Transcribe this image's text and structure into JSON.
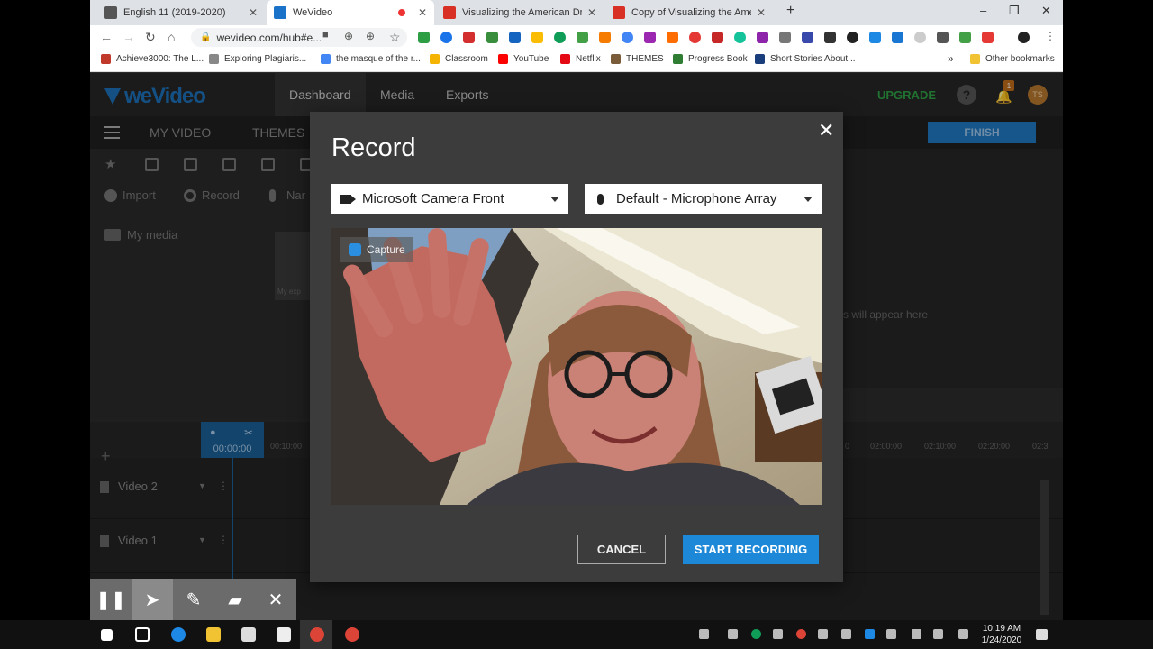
{
  "browser": {
    "tabs": [
      {
        "label": "English 11 (2019-2020)",
        "favicon_color": "#555555",
        "active": false
      },
      {
        "label": "WeVideo",
        "favicon_color": "#1a73c8",
        "active": true
      },
      {
        "label": "Visualizing the American Dream",
        "favicon_color": "#d93025",
        "active": false
      },
      {
        "label": "Copy of Visualizing the American",
        "favicon_color": "#d93025",
        "active": false
      }
    ],
    "new_tab": "+",
    "window_controls": {
      "minimize": "–",
      "maximize": "❐",
      "close": "✕"
    },
    "url": "wevideo.com/hub#e..."
  },
  "bookmarks": [
    {
      "label": "Achieve3000: The L...",
      "color": "#c0392b"
    },
    {
      "label": "Exploring Plagiaris...",
      "color": "#888888"
    },
    {
      "label": "the masque of the r...",
      "color": "#4285f4"
    },
    {
      "label": "Classroom",
      "color": "#f4b400"
    },
    {
      "label": "YouTube",
      "color": "#ff0000"
    },
    {
      "label": "Netflix",
      "color": "#e50914"
    },
    {
      "label": "THEMES",
      "color": "#7a5c3a"
    },
    {
      "label": "Progress Book",
      "color": "#2e7d32"
    },
    {
      "label": "Short Stories About...",
      "color": "#1a3d7c"
    }
  ],
  "bookmarks_more": "»",
  "other_bookmarks": "Other bookmarks",
  "app": {
    "logo": "weVideo",
    "nav": [
      "Dashboard",
      "Media",
      "Exports"
    ],
    "upgrade": "UPGRADE",
    "help": "?",
    "notification_count": "1",
    "avatar": "TS"
  },
  "editor": {
    "my_video": "MY VIDEO",
    "themes": "THEMES",
    "finish": "FINISH",
    "actions": [
      "Import",
      "Record",
      "Nar"
    ],
    "my_media": "My media",
    "thumb_caption": "My exp",
    "preview_hint": "s will appear here"
  },
  "timeline": {
    "playhead_time": "00:00:00",
    "ticks": [
      "00:10:00",
      "0",
      "02:00:00",
      "02:10:00",
      "02:20:00",
      "02:3"
    ],
    "tracks": [
      "Video 2",
      "Video 1"
    ]
  },
  "modal": {
    "title": "Record",
    "close": "✕",
    "camera": "Microsoft Camera Front",
    "microphone": "Default - Microphone Array",
    "capture_badge": "Capture",
    "cancel": "CANCEL",
    "start": "START RECORDING"
  },
  "annotation_toolbar": [
    "pause",
    "pointer",
    "pen",
    "highlighter",
    "close"
  ],
  "taskbar": {
    "time": "10:19 AM",
    "date": "1/24/2020"
  }
}
